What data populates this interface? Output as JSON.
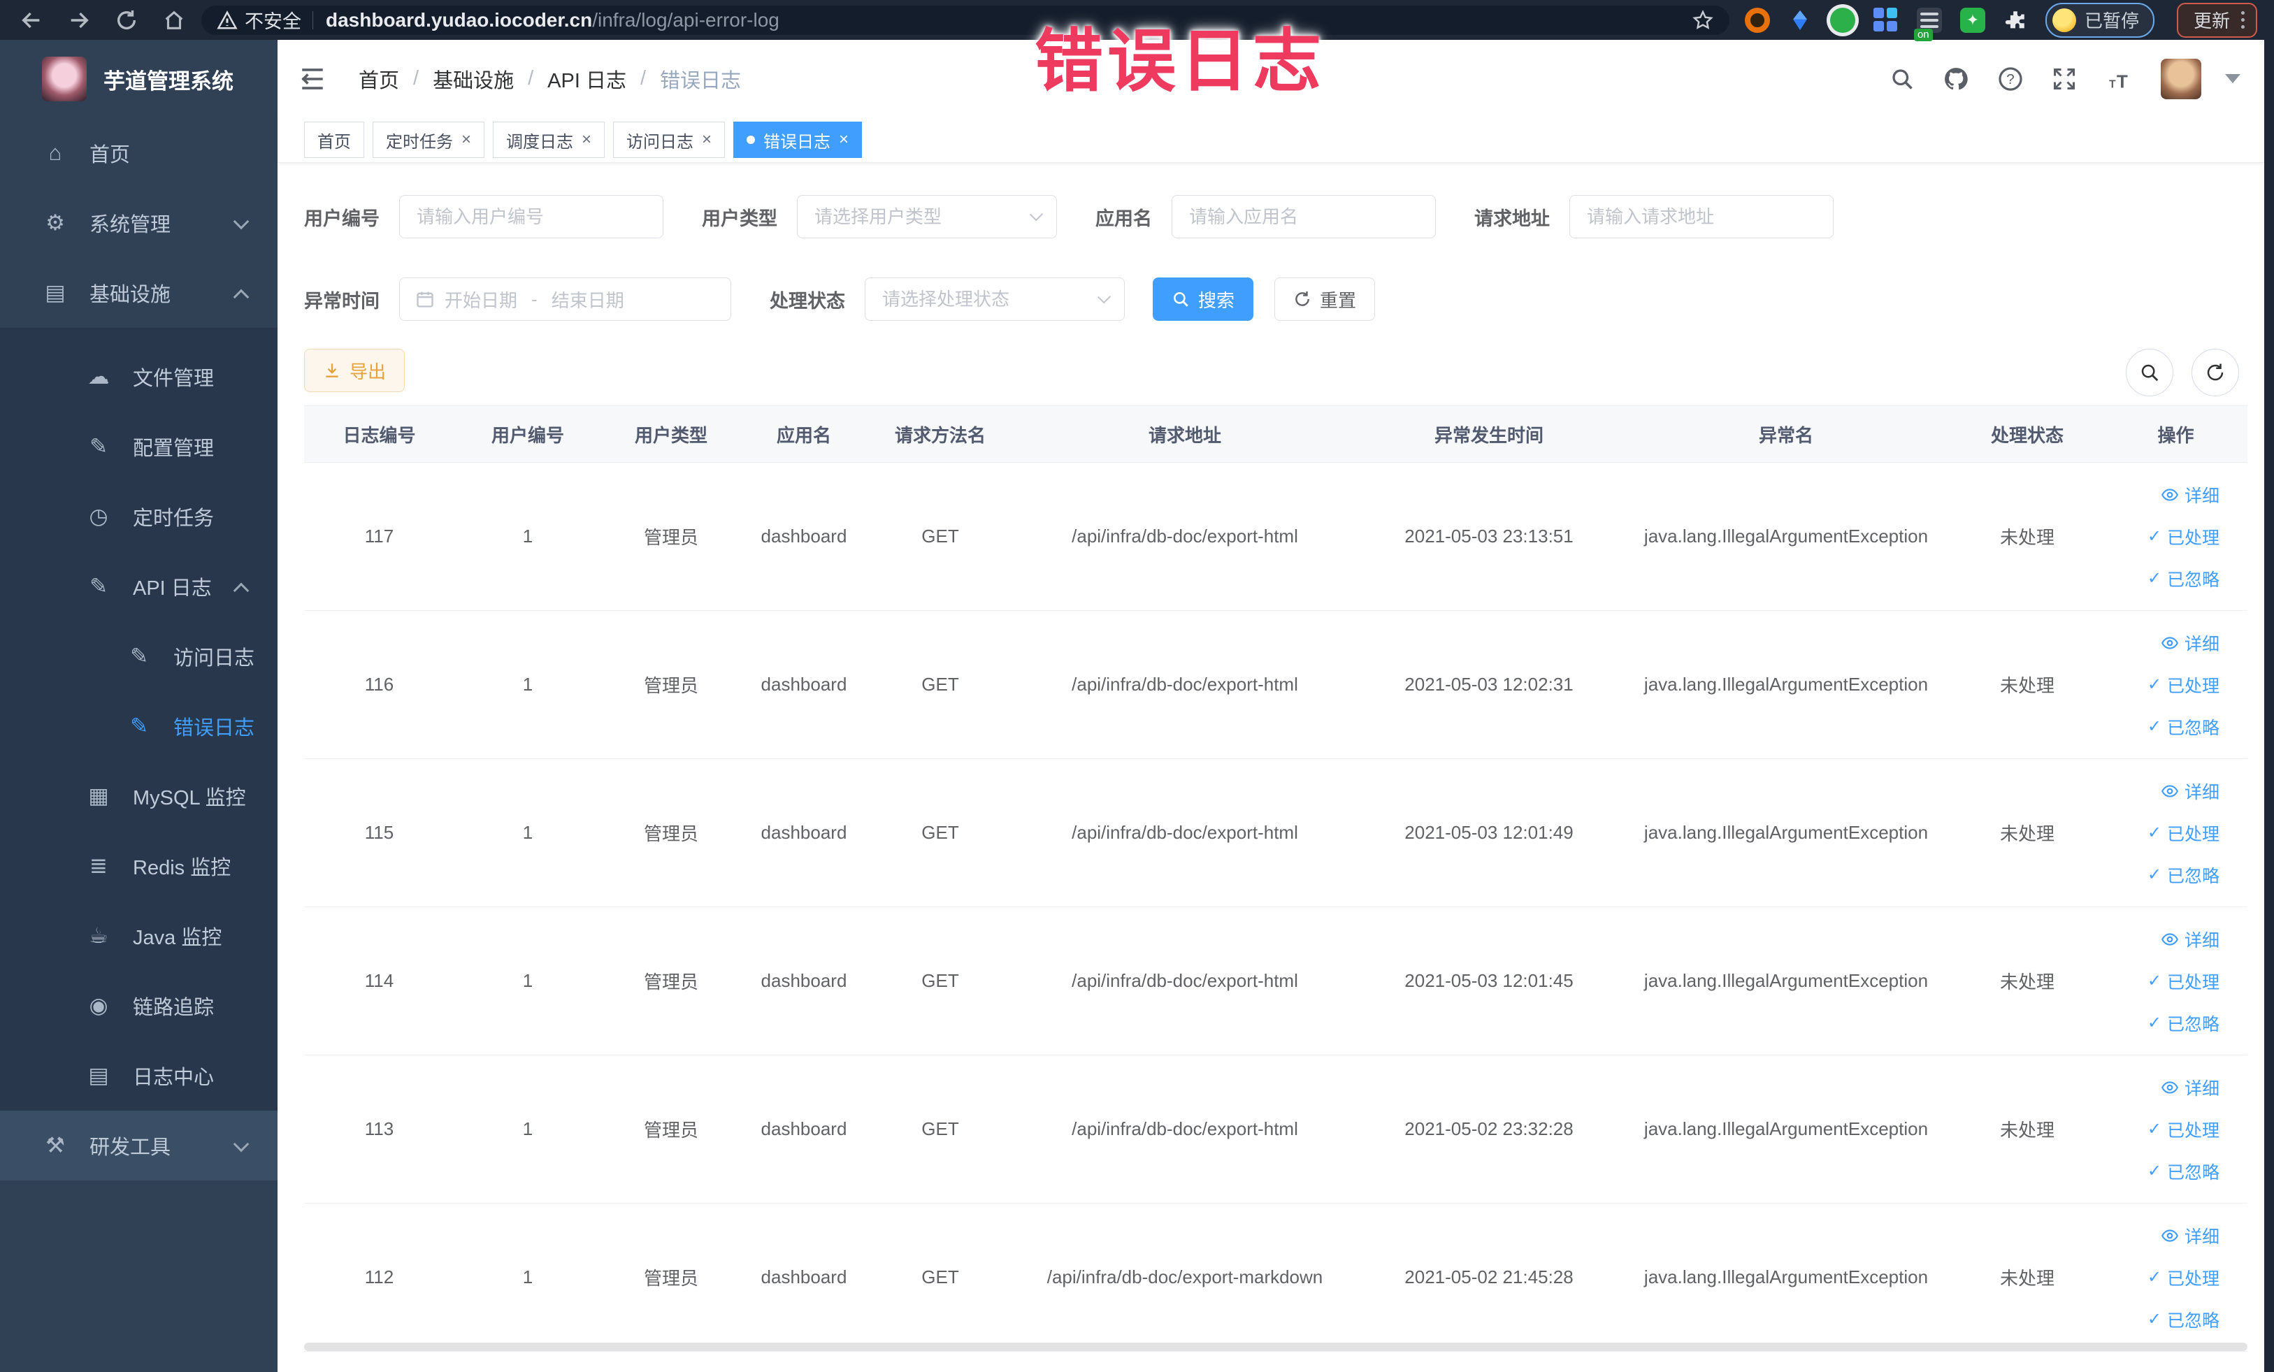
{
  "colors": {
    "primary": "#409eff",
    "warning": "#e6a23c",
    "watermark_pink": "#ee3a5f",
    "sidebar_bg": "#304156",
    "sidebar_active": "#409eff"
  },
  "overlay": {
    "watermark": "错误日志"
  },
  "icons": {
    "close": "×",
    "check": "✓"
  },
  "browser": {
    "security_label": "不安全",
    "url_domain": "dashboard.yudao.iocoder.cn",
    "url_path": "/infra/log/api-error-log",
    "extension_badge": "on",
    "paused_label": "已暂停",
    "update_label": "更新"
  },
  "sidebar": {
    "title": "芋道管理系统",
    "items": [
      {
        "label": "首页",
        "icon": "home",
        "glyph": "⌂"
      },
      {
        "label": "系统管理",
        "icon": "gear",
        "glyph": "⚙",
        "chevron": "down"
      },
      {
        "label": "基础设施",
        "icon": "infrastructure",
        "glyph": "▤",
        "chevron": "up"
      },
      {
        "label": "文件管理",
        "icon": "file-upload",
        "glyph": "☁"
      },
      {
        "label": "配置管理",
        "icon": "config",
        "glyph": "✎"
      },
      {
        "label": "定时任务",
        "icon": "timer",
        "glyph": "◷"
      },
      {
        "label": "API 日志",
        "icon": "api-log",
        "glyph": "✎",
        "chevron": "up"
      },
      {
        "label": "访问日志",
        "icon": "access-log",
        "glyph": "✎"
      },
      {
        "label": "错误日志",
        "icon": "error-log",
        "glyph": "✎",
        "active": true
      },
      {
        "label": "MySQL 监控",
        "icon": "mysql-monitor",
        "glyph": "▦"
      },
      {
        "label": "Redis 监控",
        "icon": "redis-monitor",
        "glyph": "≣"
      },
      {
        "label": "Java 监控",
        "icon": "java-monitor",
        "glyph": "☕"
      },
      {
        "label": "链路追踪",
        "icon": "trace",
        "glyph": "◉"
      },
      {
        "label": "日志中心",
        "icon": "log-center",
        "glyph": "▤"
      },
      {
        "label": "研发工具",
        "icon": "dev-tools",
        "glyph": "⚒",
        "chevron": "down"
      }
    ]
  },
  "breadcrumb": {
    "items": [
      "首页",
      "基础设施",
      "API 日志",
      "错误日志"
    ],
    "separator": "/"
  },
  "tabs": [
    {
      "label": "首页",
      "closable": false,
      "active": false
    },
    {
      "label": "定时任务",
      "closable": true,
      "active": false
    },
    {
      "label": "调度日志",
      "closable": true,
      "active": false
    },
    {
      "label": "访问日志",
      "closable": true,
      "active": false
    },
    {
      "label": "错误日志",
      "closable": true,
      "active": true
    }
  ],
  "filters": {
    "user_id": {
      "label": "用户编号",
      "placeholder": "请输入用户编号"
    },
    "user_type": {
      "label": "用户类型",
      "placeholder": "请选择用户类型"
    },
    "app_name": {
      "label": "应用名",
      "placeholder": "请输入应用名"
    },
    "request_url": {
      "label": "请求地址",
      "placeholder": "请输入请求地址"
    },
    "exception_time": {
      "label": "异常时间",
      "start_placeholder": "开始日期",
      "separator": "-",
      "end_placeholder": "结束日期"
    },
    "process_status": {
      "label": "处理状态",
      "placeholder": "请选择处理状态"
    },
    "search_label": "搜索",
    "reset_label": "重置"
  },
  "toolbar": {
    "export_label": "导出"
  },
  "table": {
    "columns": [
      "日志编号",
      "用户编号",
      "用户类型",
      "应用名",
      "请求方法名",
      "请求地址",
      "异常发生时间",
      "异常名",
      "处理状态",
      "操作"
    ],
    "action_labels": [
      "详细",
      "已处理",
      "已忽略"
    ],
    "rows": [
      {
        "id": "117",
        "user_id": "1",
        "user_type": "管理员",
        "app": "dashboard",
        "method": "GET",
        "url": "/api/infra/db-doc/export-html",
        "time": "2021-05-03 23:13:51",
        "exception": "java.lang.IllegalArgumentException",
        "status": "未处理"
      },
      {
        "id": "116",
        "user_id": "1",
        "user_type": "管理员",
        "app": "dashboard",
        "method": "GET",
        "url": "/api/infra/db-doc/export-html",
        "time": "2021-05-03 12:02:31",
        "exception": "java.lang.IllegalArgumentException",
        "status": "未处理"
      },
      {
        "id": "115",
        "user_id": "1",
        "user_type": "管理员",
        "app": "dashboard",
        "method": "GET",
        "url": "/api/infra/db-doc/export-html",
        "time": "2021-05-03 12:01:49",
        "exception": "java.lang.IllegalArgumentException",
        "status": "未处理"
      },
      {
        "id": "114",
        "user_id": "1",
        "user_type": "管理员",
        "app": "dashboard",
        "method": "GET",
        "url": "/api/infra/db-doc/export-html",
        "time": "2021-05-03 12:01:45",
        "exception": "java.lang.IllegalArgumentException",
        "status": "未处理"
      },
      {
        "id": "113",
        "user_id": "1",
        "user_type": "管理员",
        "app": "dashboard",
        "method": "GET",
        "url": "/api/infra/db-doc/export-html",
        "time": "2021-05-02 23:32:28",
        "exception": "java.lang.IllegalArgumentException",
        "status": "未处理"
      },
      {
        "id": "112",
        "user_id": "1",
        "user_type": "管理员",
        "app": "dashboard",
        "method": "GET",
        "url": "/api/infra/db-doc/export-markdown",
        "time": "2021-05-02 21:45:28",
        "exception": "java.lang.IllegalArgumentException",
        "status": "未处理"
      }
    ]
  }
}
